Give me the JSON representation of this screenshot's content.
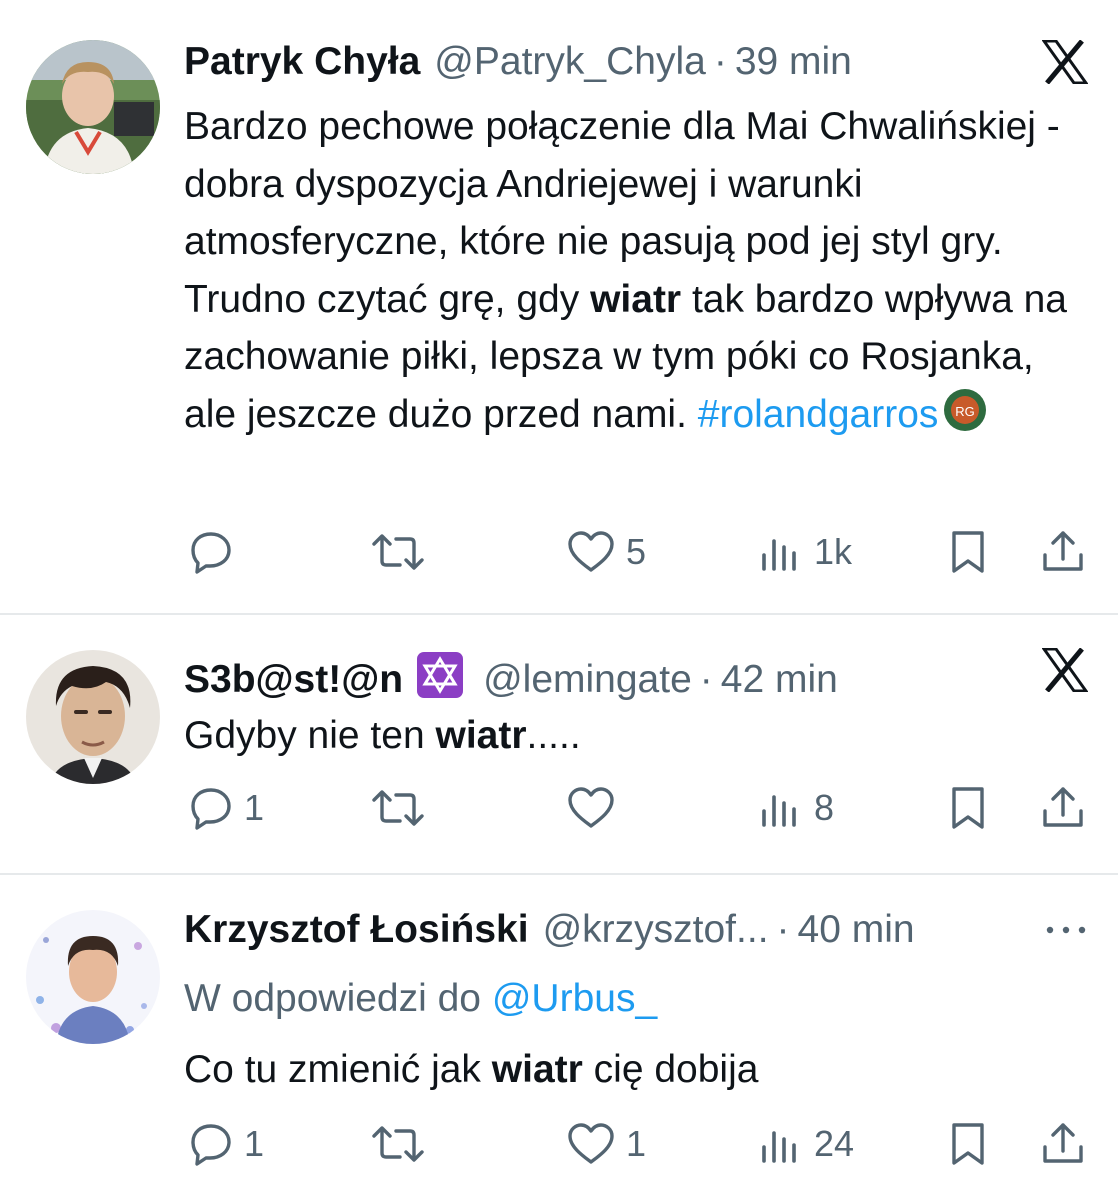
{
  "tweets": [
    {
      "name": "Patryk Chyła",
      "handle": "@Patryk_Chyla",
      "sep": "·",
      "time": "39 min",
      "corner_icon": "x-logo-icon",
      "body": {
        "t1": "Bardzo pechowe połączenie dla Mai Chwalińskiej - dobra dyspozycja Andriejewej i warunki atmosferyczne, które nie pasują pod jej styl gry. Trudno czytać grę, gdy ",
        "b1": "wiatr",
        "t2": " tak bardzo wpływa na zachowanie piłki, lepsza w tym póki co Rosjanka, ale jeszcze dużo przed nami. ",
        "hashtag": "#rolandgarros"
      },
      "actions": {
        "replies": "",
        "retweets": "",
        "likes": "5",
        "views": "1k"
      }
    },
    {
      "name": "S3b@st!@n",
      "badge_icon": "star-of-david-icon",
      "handle": "@lemingate",
      "sep": "·",
      "time": "42 min",
      "corner_icon": "x-logo-icon",
      "body": {
        "t1": "Gdyby nie ten ",
        "b1": "wiatr",
        "t2": "....."
      },
      "actions": {
        "replies": "1",
        "retweets": "",
        "likes": "",
        "views": "8"
      }
    },
    {
      "name": "Krzysztof Łosiński",
      "handle": "@krzysztof...",
      "sep": "·",
      "time": "40 min",
      "corner_icon": "more-dots-icon",
      "reply_prefix": "W odpowiedzi do ",
      "reply_mention": "@Urbus_",
      "body": {
        "t1": "Co tu zmienić jak ",
        "b1": "wiatr",
        "t2": " cię dobija"
      },
      "actions": {
        "replies": "1",
        "retweets": "",
        "likes": "1",
        "views": "24"
      }
    }
  ],
  "colors": {
    "text": "#0f1419",
    "muted": "#536471",
    "link": "#1d9bf0",
    "divider": "#e6e9eb"
  }
}
